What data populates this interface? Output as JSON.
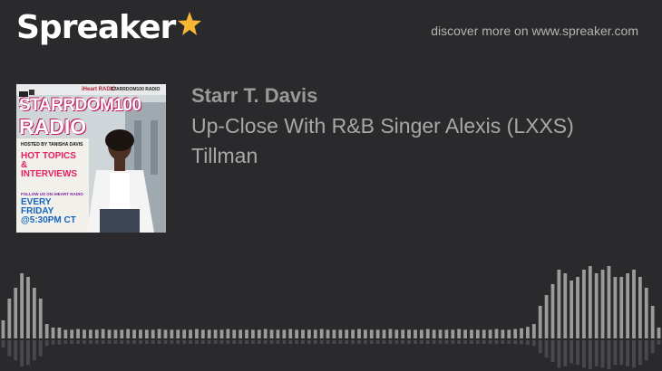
{
  "brand": {
    "name": "Spreaker",
    "accent_color": "#f7b733",
    "star_icon": "star-icon"
  },
  "header": {
    "discover_text": "discover more on www.spreaker.com"
  },
  "cover": {
    "iheart": "iHeart RADIO",
    "station": "STARRDOM100 RADIO",
    "title_line1": "STARRDOM100",
    "title_line2": "RADIO",
    "hosted_by": "HOSTED BY TANISHA DAVIS",
    "hot_topics": [
      "HOT TOPICS",
      "&",
      "INTERVIEWS"
    ],
    "follow": "FOLLOW US ON iHEART RADIO",
    "schedule": [
      "EVERY",
      "FRIDAY",
      "@5:30PM CT"
    ]
  },
  "episode": {
    "author": "Starr T. Davis",
    "title": "Up-Close With R&B Singer Alexis (LXXS) Tillman"
  },
  "waveform": {
    "color": "#9b9b9b",
    "levels": [
      0.25,
      0.55,
      0.7,
      0.9,
      0.85,
      0.7,
      0.55,
      0.2,
      0.15,
      0.15,
      0.12,
      0.12,
      0.13,
      0.12,
      0.12,
      0.12,
      0.13,
      0.12,
      0.12,
      0.12,
      0.13,
      0.12,
      0.12,
      0.12,
      0.12,
      0.13,
      0.12,
      0.12,
      0.12,
      0.12,
      0.12,
      0.13,
      0.12,
      0.12,
      0.12,
      0.12,
      0.13,
      0.12,
      0.12,
      0.12,
      0.12,
      0.12,
      0.13,
      0.12,
      0.12,
      0.12,
      0.13,
      0.12,
      0.12,
      0.12,
      0.12,
      0.13,
      0.12,
      0.12,
      0.12,
      0.12,
      0.12,
      0.13,
      0.12,
      0.12,
      0.12,
      0.12,
      0.13,
      0.12,
      0.12,
      0.12,
      0.12,
      0.12,
      0.13,
      0.12,
      0.12,
      0.12,
      0.12,
      0.13,
      0.12,
      0.12,
      0.12,
      0.12,
      0.12,
      0.13,
      0.12,
      0.12,
      0.13,
      0.14,
      0.16,
      0.2,
      0.45,
      0.6,
      0.75,
      0.95,
      0.9,
      0.8,
      0.85,
      0.95,
      1.0,
      0.9,
      0.95,
      1.0,
      0.85,
      0.85,
      0.9,
      0.95,
      0.85,
      0.7,
      0.45,
      0.15
    ]
  }
}
